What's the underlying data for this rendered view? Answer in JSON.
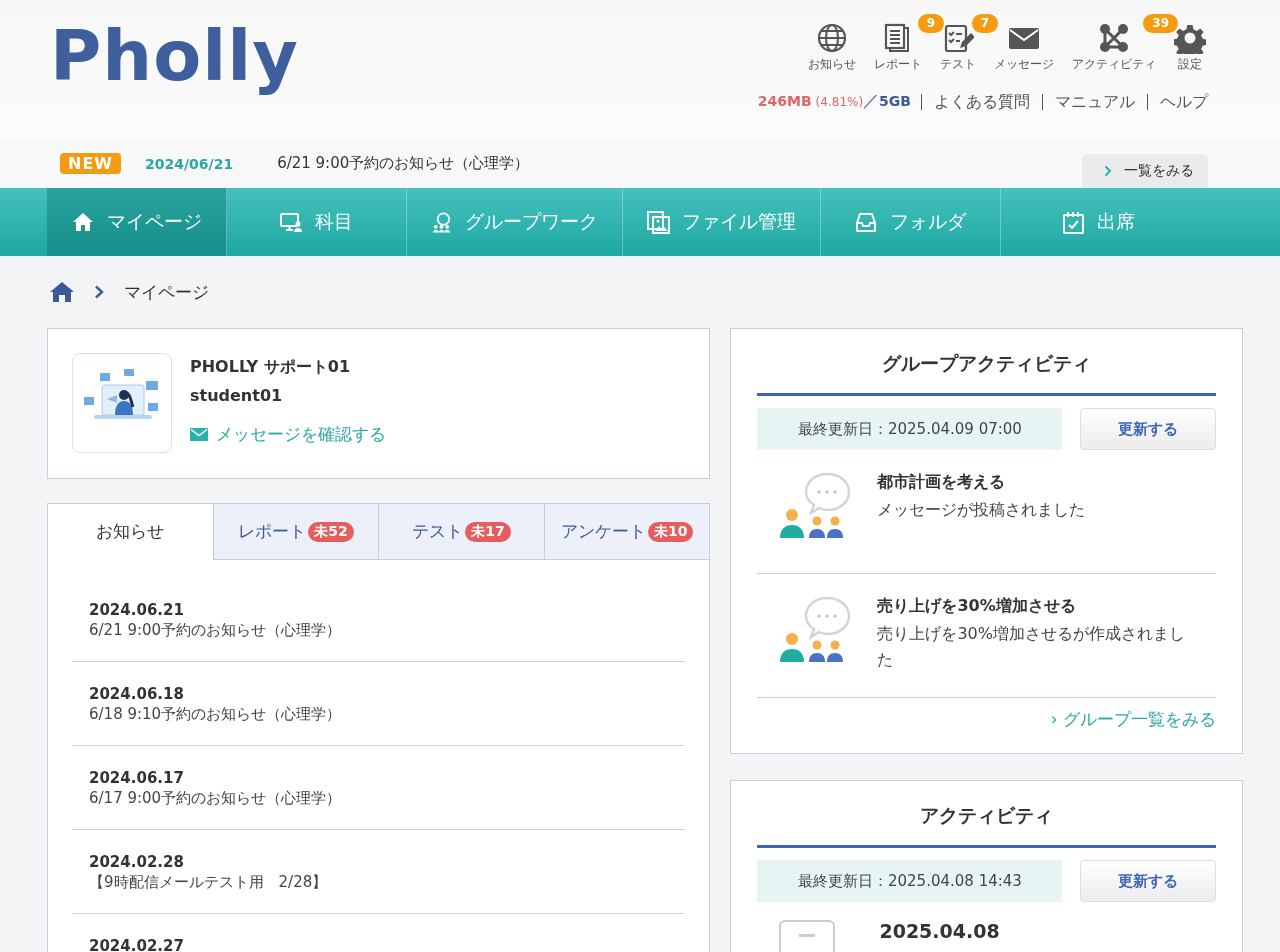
{
  "logo": "Pholly",
  "header_icons": [
    {
      "label": "お知らせ"
    },
    {
      "label": "レポート",
      "badge": "9"
    },
    {
      "label": "テスト",
      "badge": "7"
    },
    {
      "label": "メッセージ"
    },
    {
      "label": "アクティビティ",
      "badge": "39"
    },
    {
      "label": "設定"
    }
  ],
  "storage": {
    "used": "246MB",
    "percent": "(4.81%)",
    "separator": "／",
    "total": "5GB"
  },
  "header_links": [
    "よくある質問",
    "マニュアル",
    "ヘルプ"
  ],
  "news_bar": {
    "badge": "NEW",
    "date": "2024/06/21",
    "text": "6/21 9:00予約のお知らせ（心理学）",
    "button": "一覧をみる"
  },
  "nav": [
    {
      "label": "マイページ",
      "selected": true
    },
    {
      "label": "科目",
      "selected": false
    },
    {
      "label": "グループワーク",
      "selected": false
    },
    {
      "label": "ファイル管理",
      "selected": false
    },
    {
      "label": "フォルダ",
      "selected": false
    },
    {
      "label": "出席",
      "selected": false
    }
  ],
  "breadcrumb": [
    "マイページ"
  ],
  "profile": {
    "name": "PHOLLY サポート01",
    "user_id": "student01",
    "link": "メッセージを確認する"
  },
  "notice_tabs": [
    {
      "label": "お知らせ",
      "selected": true
    },
    {
      "label": "レポート",
      "badge": "未52",
      "selected": false
    },
    {
      "label": "テスト",
      "badge": "未17",
      "selected": false
    },
    {
      "label": "アンケート",
      "badge": "未10",
      "selected": false
    }
  ],
  "notices": [
    {
      "date": "2024.06.21",
      "text": "6/21 9:00予約のお知らせ（心理学）"
    },
    {
      "date": "2024.06.18",
      "text": "6/18 9:10予約のお知らせ（心理学）"
    },
    {
      "date": "2024.06.17",
      "text": "6/17 9:00予約のお知らせ（心理学）"
    },
    {
      "date": "2024.02.28",
      "text": "【9時配信メールテスト用　2/28】"
    },
    {
      "date": "2024.02.27"
    }
  ],
  "group_activity": {
    "title": "グループアクティビティ",
    "updated": "最終更新日：2025.04.09 07:00",
    "button": "更新する",
    "items": [
      {
        "title": "都市計画を考える",
        "text": "メッセージが投稿されました"
      },
      {
        "title": "売り上げを30%増加させる",
        "text": "売り上げを30%増加させるが作成されました"
      }
    ],
    "link": "› グループ一覧をみる"
  },
  "activity": {
    "title": "アクティビティ",
    "updated": "最終更新日：2025.04.08 14:43",
    "button": "更新する",
    "items": [
      {
        "date": "2025.04.08"
      }
    ]
  }
}
